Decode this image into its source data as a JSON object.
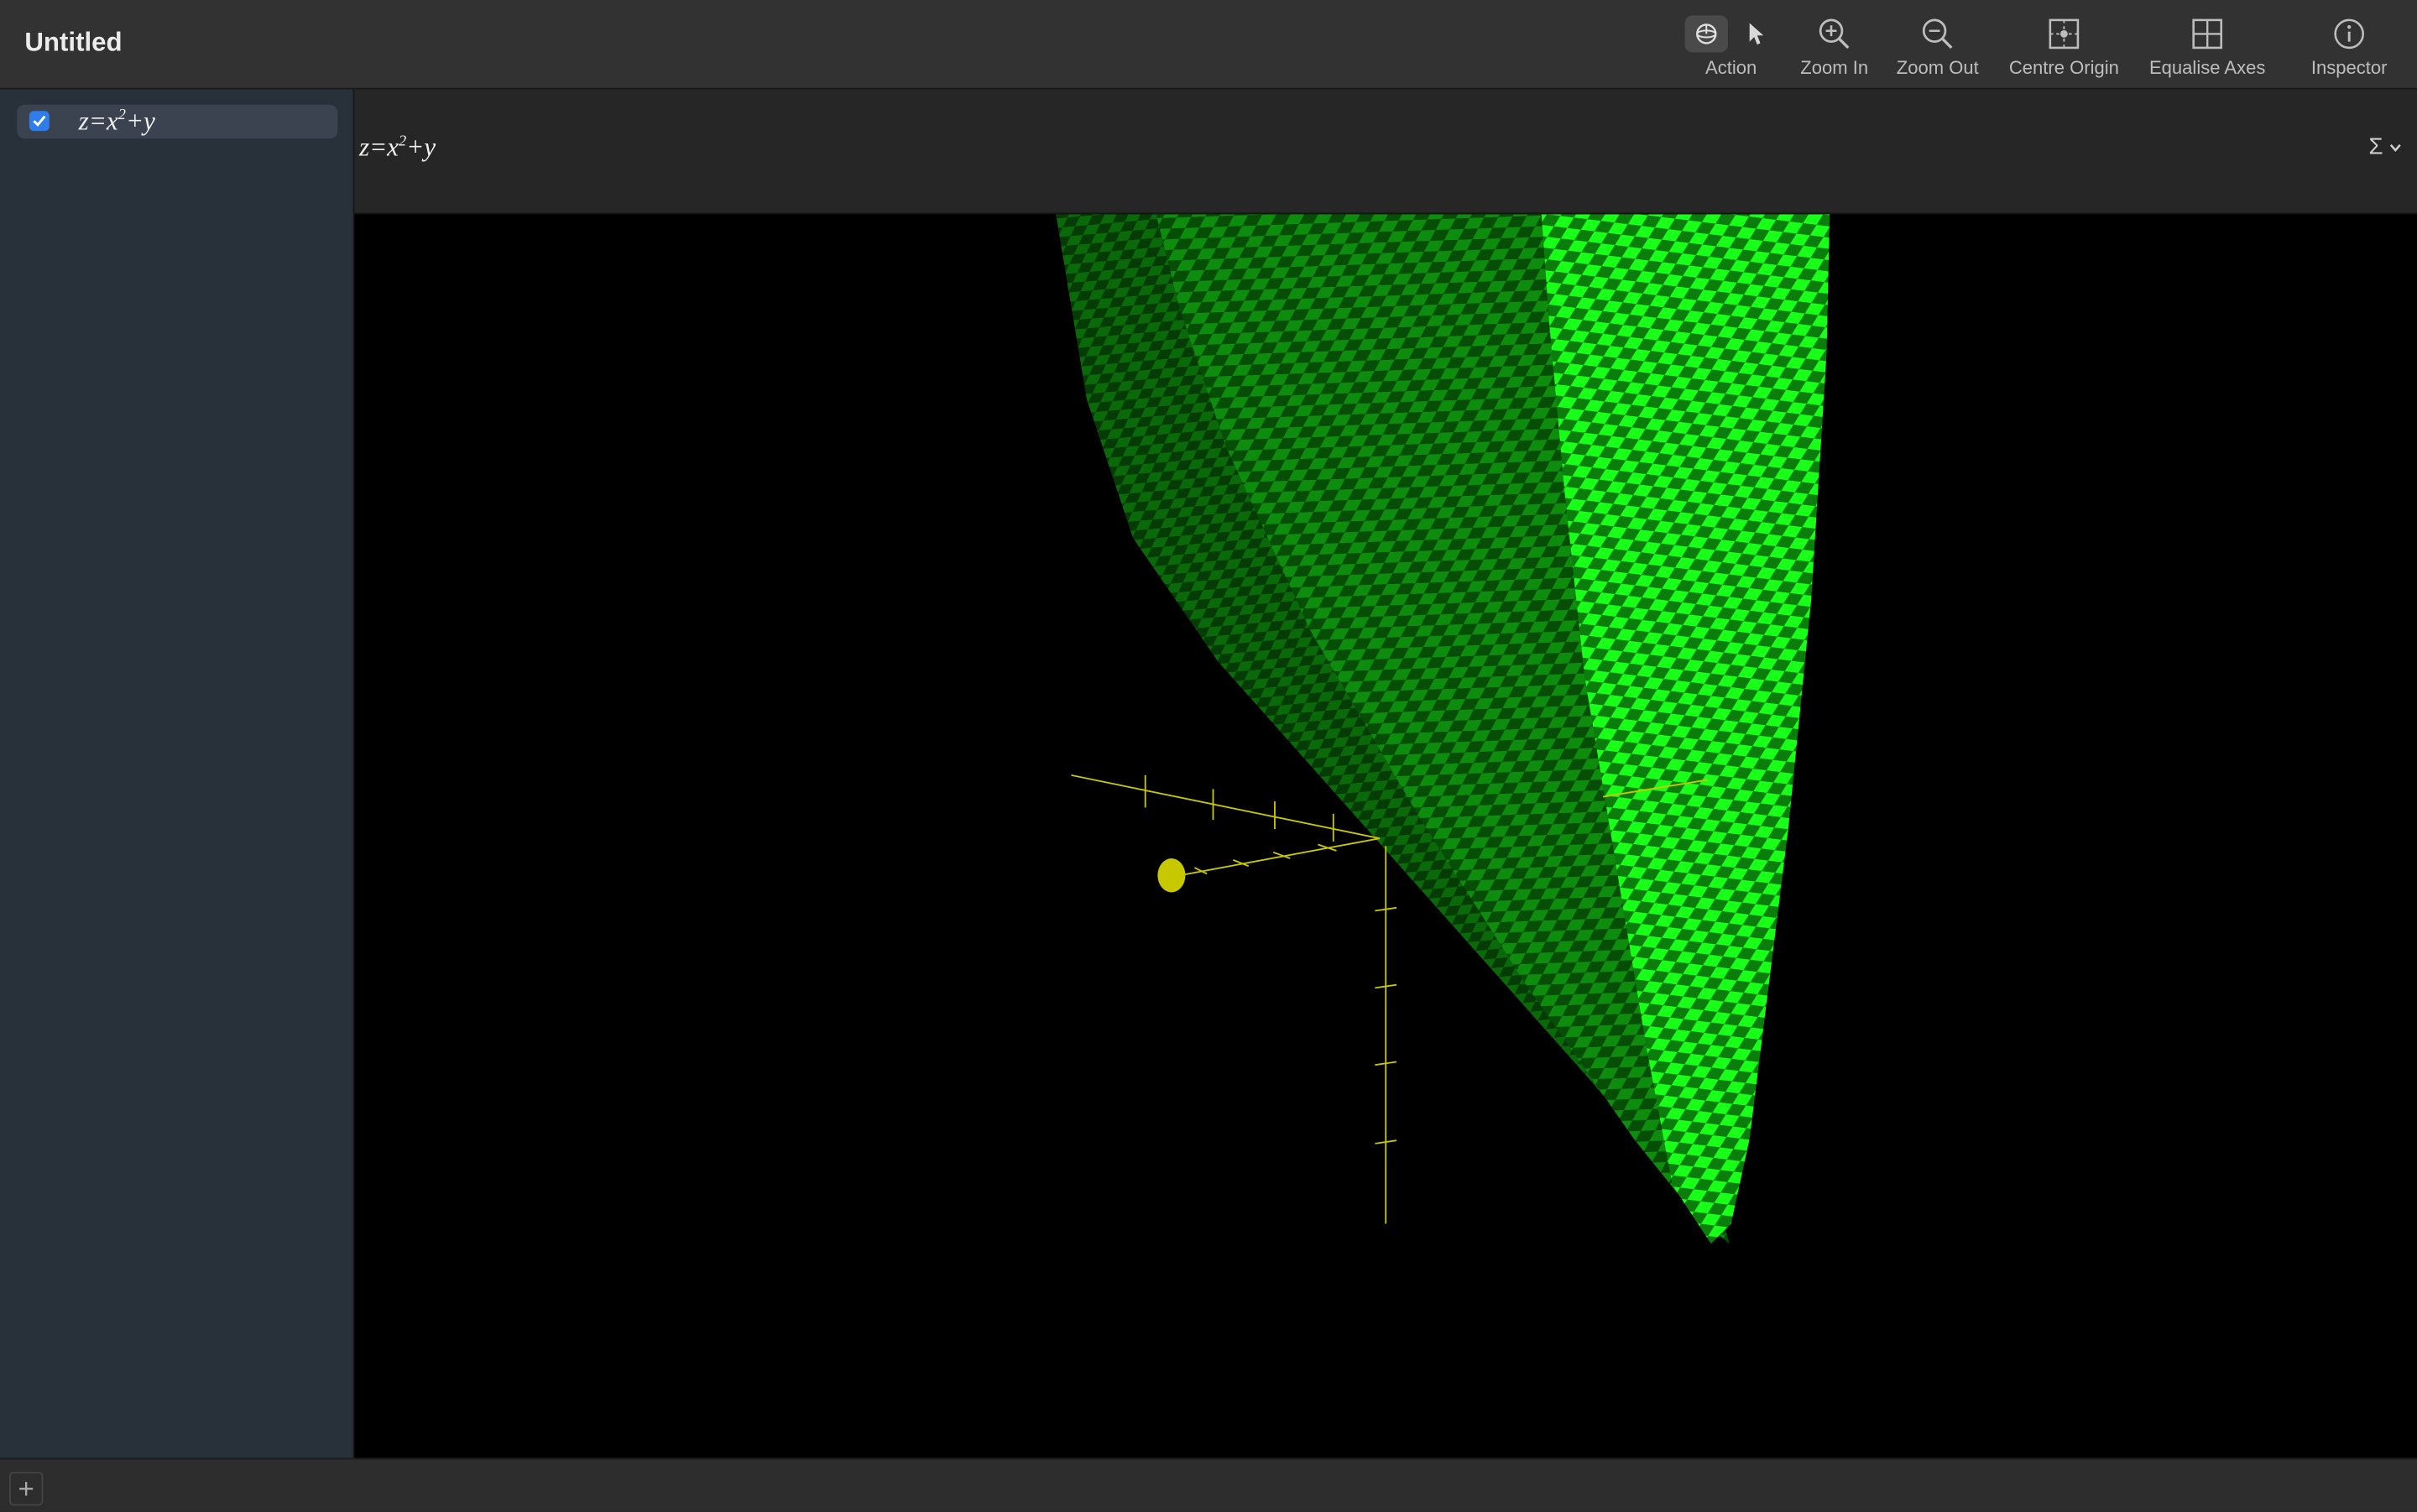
{
  "window": {
    "title": "Untitled"
  },
  "toolbar": {
    "action_label": "Action",
    "zoom_in_label": "Zoom In",
    "zoom_out_label": "Zoom Out",
    "centre_origin_label": "Centre Origin",
    "equalise_axes_label": "Equalise Axes",
    "inspector_label": "Inspector"
  },
  "sidebar": {
    "equations": [
      {
        "lhs": "z=x",
        "exponent": "2",
        "rhs": "+y",
        "checked": true
      }
    ]
  },
  "equation_header": {
    "lhs": "z=x",
    "exponent": "2",
    "rhs": "+y",
    "sigma_symbol": "Σ"
  },
  "graph": {
    "surface_color_light": "#19ff19",
    "surface_color_dark": "#0a7a0a",
    "axis_color": "#c8c800",
    "background": "#000000"
  },
  "bottom": {
    "add_symbol": "+"
  }
}
